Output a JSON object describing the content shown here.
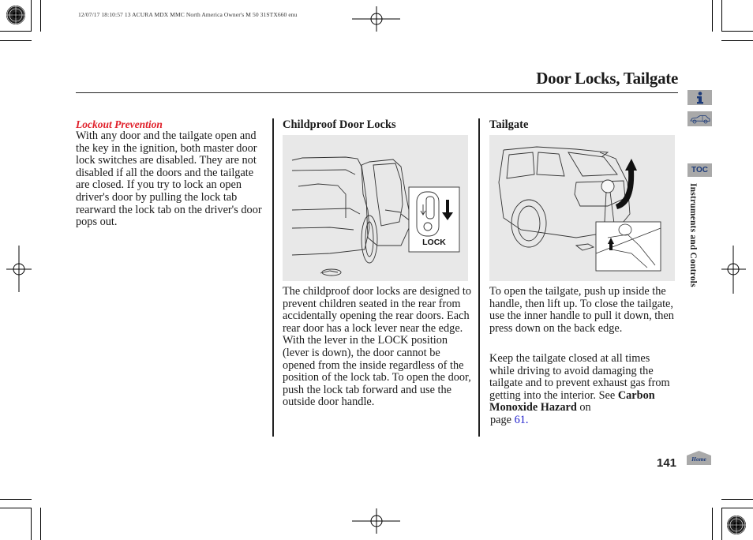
{
  "print_header": "12/07/17 18:10:57   13 ACURA MDX MMC North America Owner's M 50 31STX660 enu",
  "page_title": "Door Locks, Tailgate",
  "side_nav": {
    "info_icon": "info-icon",
    "car_icon": "car-icon",
    "toc_label": "TOC",
    "section_label": "Instruments and Controls",
    "home_label": "Home"
  },
  "lockout": {
    "title": "Lockout Prevention",
    "body": "With any door and the tailgate open and the key in the ignition, both master door lock switches are disabled. They are not disabled if all the doors and the tailgate are closed. If you try to lock an open driver's door by pulling the lock tab rearward the lock tab on the driver's door pops out."
  },
  "childproof": {
    "heading": "Childproof Door Locks",
    "illustration_label": "LOCK",
    "body": "The childproof door locks are designed to prevent children seated in the rear from accidentally opening the rear doors. Each rear door has a lock lever near the edge. With the lever in the LOCK position (lever is down), the door cannot be opened from the inside regardless of the position of the lock tab. To open the door, push the lock tab forward and use the outside door handle."
  },
  "tailgate": {
    "heading": "Tailgate",
    "para1": "To open the tailgate, push up inside the handle, then lift up. To close the tailgate, use the inner handle to pull it down, then press down on the back edge.",
    "para2_prefix": "Keep the tailgate closed at all times while driving to avoid damaging the tailgate and to prevent exhaust gas from getting into the interior. See",
    "para2_ref": "Carbon Monoxide Hazard",
    "para2_on": "on",
    "page_word": "page",
    "page_link": "61."
  },
  "page_number": "141",
  "colors": {
    "accent_red": "#e0202a",
    "link_blue": "#1a1acc",
    "nav_icon_bg": "#a9a9a9",
    "nav_icon_fg": "#1c3a78",
    "illustration_bg": "#e8e8e8"
  }
}
